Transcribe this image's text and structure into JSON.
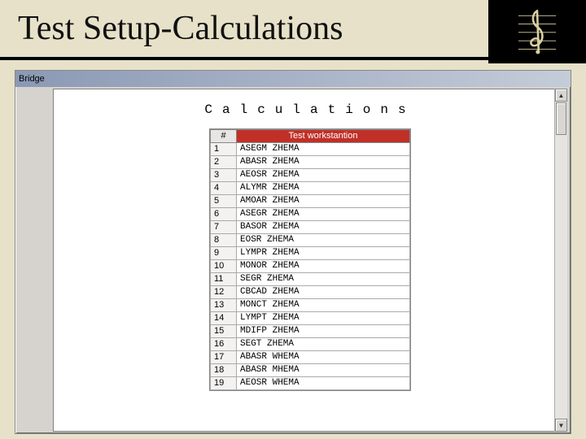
{
  "slide": {
    "title": "Test Setup-Calculations"
  },
  "window": {
    "title": "Bridge",
    "heading": "Calculations"
  },
  "table": {
    "headers": {
      "num": "#",
      "workstation": "Test workstantion"
    },
    "rows": [
      {
        "n": "1",
        "v": "ASEGM ZHEMA"
      },
      {
        "n": "2",
        "v": "ABASR ZHEMA"
      },
      {
        "n": "3",
        "v": "AEOSR ZHEMA"
      },
      {
        "n": "4",
        "v": "ALYMR ZHEMA"
      },
      {
        "n": "5",
        "v": "AMOAR ZHEMA"
      },
      {
        "n": "6",
        "v": "ASEGR ZHEMA"
      },
      {
        "n": "7",
        "v": "BASOR ZHEMA"
      },
      {
        "n": "8",
        "v": "EOSR  ZHEMA"
      },
      {
        "n": "9",
        "v": "LYMPR ZHEMA"
      },
      {
        "n": "10",
        "v": "MONOR ZHEMA"
      },
      {
        "n": "11",
        "v": "SEGR  ZHEMA"
      },
      {
        "n": "12",
        "v": "CBCAD ZHEMA"
      },
      {
        "n": "13",
        "v": "MONCT ZHEMA"
      },
      {
        "n": "14",
        "v": "LYMPT ZHEMA"
      },
      {
        "n": "15",
        "v": "MDIFP ZHEMA"
      },
      {
        "n": "16",
        "v": "SEGT  ZHEMA"
      },
      {
        "n": "17",
        "v": "ABASR WHEMA"
      },
      {
        "n": "18",
        "v": "ABASR MHEMA"
      },
      {
        "n": "19",
        "v": "AEOSR WHEMA"
      }
    ]
  }
}
